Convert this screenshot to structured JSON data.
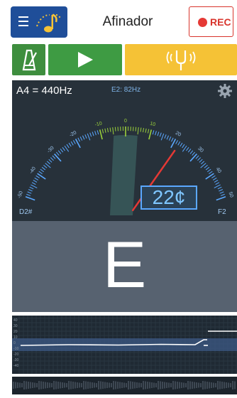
{
  "header": {
    "title": "Afinador",
    "rec_label": "REC",
    "menu_icon": "hamburger-icon",
    "logo_icon": "music-note-icon"
  },
  "toolbar": {
    "metronome_icon": "metronome-icon",
    "play_icon": "play-icon",
    "fork_icon": "tuning-fork-icon"
  },
  "meter": {
    "reference": "A4 = 440Hz",
    "target_note": "E2: 82Hz",
    "cents_readout": "22¢",
    "left_note": "D2#",
    "right_note": "F2",
    "scale_labels": [
      "-50",
      "-40",
      "-30",
      "-20",
      "-10",
      "0",
      "10",
      "20",
      "30",
      "40",
      "50"
    ],
    "cents_value": 22
  },
  "note": {
    "current": "E"
  },
  "graph": {
    "y_labels": [
      "40",
      "30",
      "20",
      "10",
      "0",
      "-10",
      "-20",
      "-30",
      "-40"
    ]
  },
  "colors": {
    "brand_blue": "#1f4e99",
    "green": "#3e9b43",
    "yellow": "#f5c236",
    "rec_red": "#e53935",
    "needle": "#e53935",
    "scale_blue": "#5ba8ff",
    "scale_green": "#9bd13b"
  }
}
